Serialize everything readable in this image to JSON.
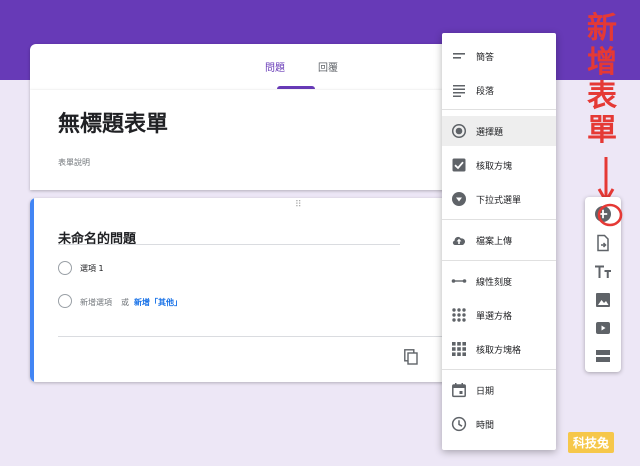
{
  "tabs": [
    {
      "label": "問題",
      "active": true
    },
    {
      "label": "回覆",
      "active": false
    }
  ],
  "form": {
    "title": "無標題表單",
    "description_placeholder": "表單說明"
  },
  "question": {
    "title": "未命名的問題",
    "options": [
      "選項 1"
    ],
    "add_option": "新增選項",
    "or": "或",
    "add_other": "新增「其他」"
  },
  "type_menu": {
    "items": [
      {
        "label": "簡答",
        "icon": "short-answer-icon"
      },
      {
        "label": "段落",
        "icon": "paragraph-icon"
      },
      {
        "label": "選擇題",
        "icon": "radio-icon",
        "selected": true
      },
      {
        "label": "核取方塊",
        "icon": "checkbox-icon"
      },
      {
        "label": "下拉式選單",
        "icon": "dropdown-icon"
      },
      {
        "label": "檔案上傳",
        "icon": "cloud-upload-icon"
      },
      {
        "label": "線性刻度",
        "icon": "linear-scale-icon"
      },
      {
        "label": "單選方格",
        "icon": "grid-icon"
      },
      {
        "label": "核取方塊格",
        "icon": "checkbox-grid-icon"
      },
      {
        "label": "日期",
        "icon": "calendar-icon"
      },
      {
        "label": "時間",
        "icon": "clock-icon"
      }
    ]
  },
  "side_toolbar": [
    "add-question-icon",
    "import-icon",
    "title-text-icon",
    "image-icon",
    "video-icon",
    "section-icon"
  ],
  "annotation": {
    "text": "新增表單"
  },
  "watermark": "科技兔",
  "colors": {
    "accent": "#673ab7",
    "background": "#ede7f6",
    "question_accent": "#4285f4",
    "annotation": "#e53935",
    "link": "#1a73e8"
  }
}
